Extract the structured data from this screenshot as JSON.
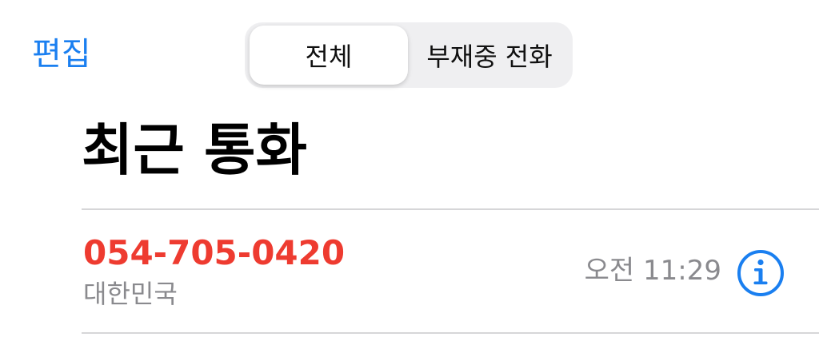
{
  "nav": {
    "edit_label": "편집"
  },
  "filter": {
    "segments": [
      {
        "label": "전체",
        "selected": true
      },
      {
        "label": "부재중 전화",
        "selected": false
      }
    ]
  },
  "header": {
    "title": "최근 통화"
  },
  "calls": [
    {
      "number": "054-705-0420",
      "location": "대한민국",
      "time": "오전 11:29",
      "missed": true,
      "icon": "info-icon"
    }
  ],
  "colors": {
    "accent": "#1a7ff0",
    "missed": "#ee3b30",
    "secondary_text": "#8a8a8e",
    "segment_bg": "#efeff1",
    "divider": "#d6d6d8"
  }
}
